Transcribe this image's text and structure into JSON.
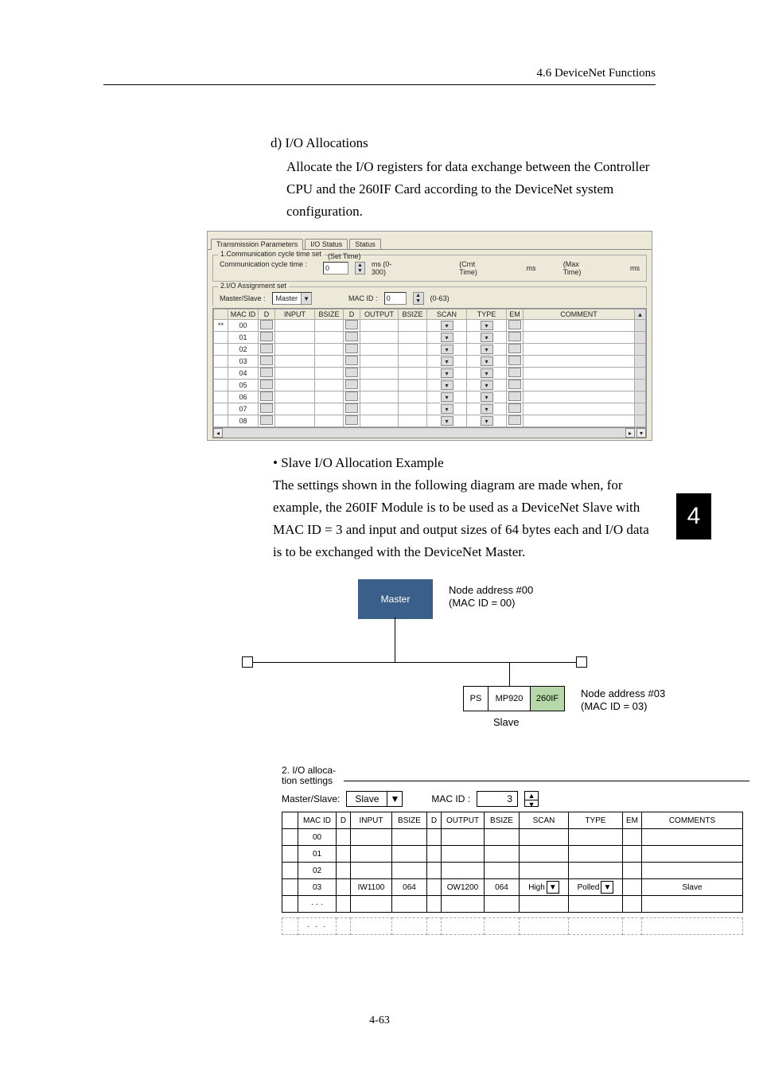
{
  "header": {
    "section": "4.6  DeviceNet Functions"
  },
  "section_d": {
    "title": "d) I/O Allocations",
    "paragraph": "Allocate the I/O registers for data exchange between the Controller CPU and the 260IF Card according to the DeviceNet system configuration."
  },
  "screenshot": {
    "tabs": [
      "Transmission Parameters",
      "I/O Status",
      "Status"
    ],
    "group1": {
      "title": "1.Communication cycle time set",
      "label": "Communication cycle time :",
      "set_time_label": "(Set Time)",
      "value": "0",
      "unit": "ms (0-300)",
      "crnt_label": "(Crnt Time)",
      "crnt_unit": "ms",
      "max_label": "(Max Time)",
      "max_unit": "ms"
    },
    "group2": {
      "title": "2.I/O Assignment set",
      "master_slave_label": "Master/Slave :",
      "master_slave_value": "Master",
      "macid_label": "MAC ID :",
      "macid_value": "0",
      "macid_range": "(0-63)"
    },
    "grid": {
      "headers": [
        "",
        "MAC ID",
        "D",
        "INPUT",
        "BSIZE",
        "D",
        "OUTPUT",
        "BSIZE",
        "SCAN",
        "TYPE",
        "EM",
        "COMMENT"
      ],
      "rows": [
        {
          "star": "**",
          "mac": "00"
        },
        {
          "star": "",
          "mac": "01"
        },
        {
          "star": "",
          "mac": "02"
        },
        {
          "star": "",
          "mac": "03"
        },
        {
          "star": "",
          "mac": "04"
        },
        {
          "star": "",
          "mac": "05"
        },
        {
          "star": "",
          "mac": "06"
        },
        {
          "star": "",
          "mac": "07"
        },
        {
          "star": "",
          "mac": "08"
        }
      ]
    }
  },
  "example": {
    "bullet_title": "•  Slave I/O Allocation Example",
    "paragraph": "The settings shown in the following diagram are made when, for example, the 260IF Module is to be used as a DeviceNet Slave with MAC ID  =  3 and input and output sizes of 64 bytes each and I/O data is to be exchanged with the DeviceNet Master."
  },
  "diagram": {
    "master": "Master",
    "node0_line1": "Node address #00",
    "node0_line2": "(MAC ID = 00)",
    "ps": "PS",
    "mp920": "MP920",
    "if260": "260IF",
    "slave": "Slave",
    "node3_line1": "Node address #03",
    "node3_line2": "(MAC ID = 03)"
  },
  "settings_table": {
    "title_line1": "2. I/O alloca-",
    "title_line2": "tion settings",
    "master_slave_label": "Master/Slave:",
    "master_slave_value": "Slave",
    "macid_label": "MAC ID :",
    "macid_value": "3",
    "headers": [
      "",
      "MAC ID",
      "D",
      "INPUT",
      "BSIZE",
      "D",
      "OUTPUT",
      "BSIZE",
      "SCAN",
      "TYPE",
      "EM",
      "COMMENTS"
    ],
    "rows": [
      {
        "mac": "00",
        "input": "",
        "ibs": "",
        "output": "",
        "obs": "",
        "scan": "",
        "type": "",
        "em": "",
        "comment": ""
      },
      {
        "mac": "01",
        "input": "",
        "ibs": "",
        "output": "",
        "obs": "",
        "scan": "",
        "type": "",
        "em": "",
        "comment": ""
      },
      {
        "mac": "02",
        "input": "",
        "ibs": "",
        "output": "",
        "obs": "",
        "scan": "",
        "type": "",
        "em": "",
        "comment": ""
      },
      {
        "mac": "03",
        "input": "IW1100",
        "ibs": "064",
        "output": "OW1200",
        "obs": "064",
        "scan": "High",
        "type": "Polled",
        "em": "",
        "comment": "Slave"
      },
      {
        "mac": "· · ·",
        "input": "",
        "ibs": "",
        "output": "",
        "obs": "",
        "scan": "",
        "type": "",
        "em": "",
        "comment": ""
      }
    ],
    "dots": "· · ·"
  },
  "chapter_tab": "4",
  "page_number": "4-63"
}
